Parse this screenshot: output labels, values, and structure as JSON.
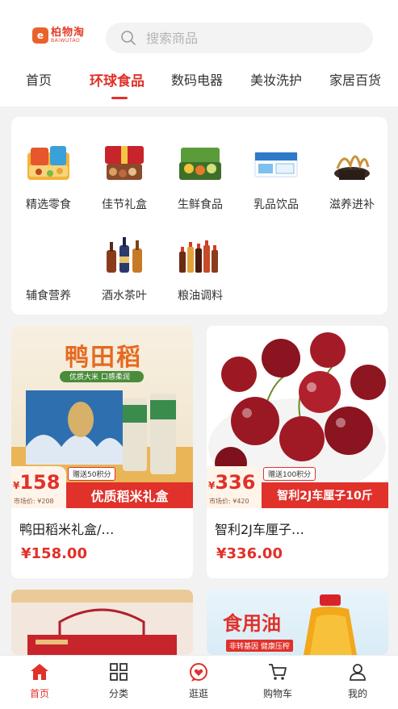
{
  "brand": {
    "name": "柏物淘",
    "sub": "BAIWUTAO"
  },
  "search": {
    "placeholder": "搜索商品"
  },
  "tabs": [
    {
      "label": "首页",
      "active": false
    },
    {
      "label": "环球食品",
      "active": true
    },
    {
      "label": "数码电器",
      "active": false
    },
    {
      "label": "美妆洗护",
      "active": false
    },
    {
      "label": "家居百货",
      "active": false
    }
  ],
  "categories": [
    {
      "label": "精选零食",
      "icon": "snacks-icon"
    },
    {
      "label": "佳节礼盒",
      "icon": "gift-box-icon"
    },
    {
      "label": "生鲜食品",
      "icon": "fresh-food-icon"
    },
    {
      "label": "乳品饮品",
      "icon": "dairy-icon"
    },
    {
      "label": "滋养进补",
      "icon": "tonic-icon"
    },
    {
      "label": "辅食营养",
      "icon": "nutrition-icon"
    },
    {
      "label": "酒水茶叶",
      "icon": "liquor-icon"
    },
    {
      "label": "粮油调料",
      "icon": "grain-oil-icon"
    }
  ],
  "products": [
    {
      "title": "鸭田稻米礼盒/…",
      "price": "¥158.00",
      "banner_price": "158",
      "banner_currency": "¥",
      "market_price": "市场价: ¥208",
      "points": "赠送50积分",
      "banner_name": "优质稻米礼盒",
      "brand_text": "鸭田稻",
      "tagline": "优质大米 口感柔润"
    },
    {
      "title": "智利2J车厘子…",
      "price": "¥336.00",
      "banner_price": "336",
      "banner_currency": "¥",
      "market_price": "市场价: ¥420",
      "points": "赠送100积分",
      "banner_name": "智利2J车厘子10斤"
    },
    {
      "title": "",
      "price": ""
    },
    {
      "title": "",
      "price": "",
      "brand_text": "食用油",
      "tagline": "非转基因 健康压榨"
    }
  ],
  "bottom_nav": [
    {
      "label": "首页",
      "icon": "home-icon",
      "active": true
    },
    {
      "label": "分类",
      "icon": "grid-icon",
      "active": false
    },
    {
      "label": "逛逛",
      "icon": "browse-heart-icon",
      "active": false
    },
    {
      "label": "购物车",
      "icon": "cart-icon",
      "active": false
    },
    {
      "label": "我的",
      "icon": "user-icon",
      "active": false
    }
  ],
  "colors": {
    "accent": "#e0312a",
    "brand": "#e8622a",
    "background": "#f2f2f2"
  }
}
